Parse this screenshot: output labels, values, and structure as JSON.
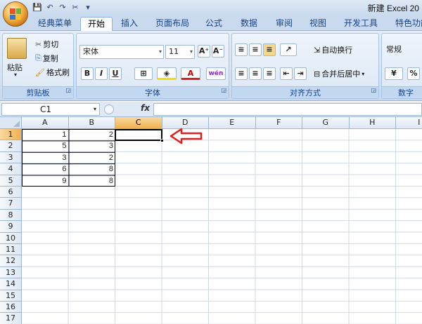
{
  "window": {
    "title": "新建 Excel 20"
  },
  "qat": {
    "save": "💾",
    "undo": "↶",
    "redo": "↷",
    "tool": "✂",
    "more": "▾"
  },
  "tabs": [
    "经典菜单",
    "开始",
    "插入",
    "页面布局",
    "公式",
    "数据",
    "审阅",
    "视图",
    "开发工具",
    "特色功能"
  ],
  "active_tab": "开始",
  "ribbon": {
    "clipboard": {
      "label": "剪贴板",
      "paste": "粘贴",
      "cut": "剪切",
      "copy": "复制",
      "format_painter": "格式刷"
    },
    "font": {
      "label": "字体",
      "font_name": "宋体",
      "font_size": "11",
      "grow": "A⁺",
      "shrink": "A⁻",
      "bold": "B",
      "italic": "I",
      "underline": "U",
      "wen": "wén"
    },
    "alignment": {
      "label": "对齐方式",
      "wrap": "自动换行",
      "merge": "合并后居中"
    },
    "number": {
      "label": "数字",
      "format": "常规",
      "percent": "%"
    }
  },
  "formula_bar": {
    "name_box": "C1",
    "fx": "fx",
    "value": ""
  },
  "sheet": {
    "columns": [
      "A",
      "B",
      "C",
      "D",
      "E",
      "F",
      "G",
      "H",
      "I"
    ],
    "rows": [
      "1",
      "2",
      "3",
      "4",
      "5",
      "6",
      "7",
      "8",
      "9",
      "10",
      "11",
      "12",
      "13",
      "14",
      "15",
      "16",
      "17"
    ],
    "data": [
      [
        "1",
        "2"
      ],
      [
        "5",
        "3"
      ],
      [
        "3",
        "2"
      ],
      [
        "6",
        "8"
      ],
      [
        "9",
        "8"
      ]
    ],
    "selected_cell": "C1"
  },
  "colors": {
    "arrow": "#e0201c",
    "selected_header": "#f1b150",
    "ribbon": "#d2e1f3"
  }
}
